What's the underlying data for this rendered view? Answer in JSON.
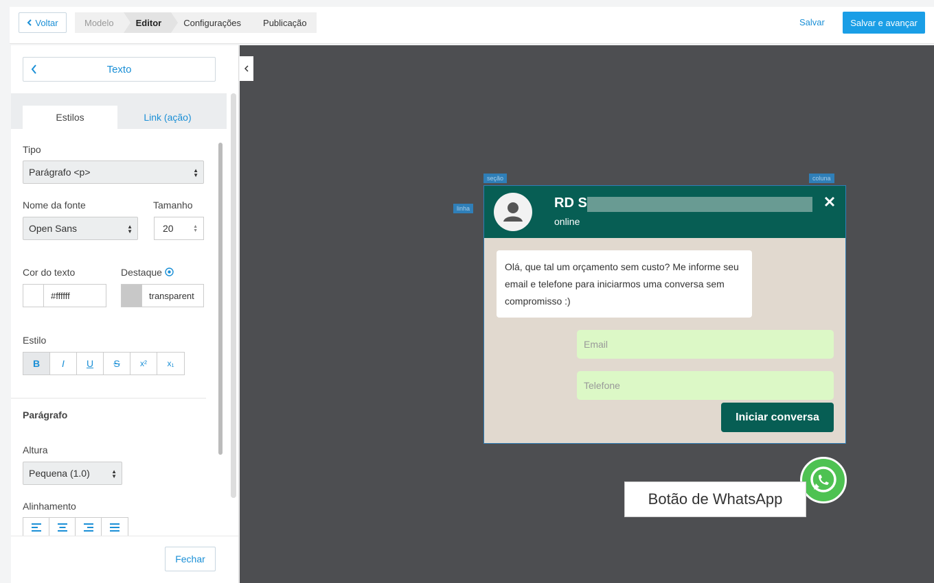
{
  "topbar": {
    "back_label": "Voltar",
    "steps": [
      {
        "label": "Modelo",
        "state": "done"
      },
      {
        "label": "Editor",
        "state": "active"
      },
      {
        "label": "Configurações",
        "state": "pending"
      },
      {
        "label": "Publicação",
        "state": "pending"
      }
    ],
    "save_label": "Salvar",
    "save_next_label": "Salvar e avançar"
  },
  "sidebar": {
    "panel_title": "Texto",
    "tabs": [
      "Estilos",
      "Link (ação)"
    ],
    "tipo_label": "Tipo",
    "tipo_value": "Parágrafo <p>",
    "fonte_label": "Nome da fonte",
    "fonte_value": "Open Sans",
    "tamanho_label": "Tamanho",
    "tamanho_value": "20",
    "cor_label": "Cor do texto",
    "cor_value": "#ffffff",
    "destaque_label": "Destaque",
    "destaque_value": "transparent",
    "estilo_label": "Estilo",
    "style_buttons": [
      "B",
      "I",
      "U",
      "S",
      "x²",
      "x₁"
    ],
    "paragrafo_label": "Parágrafo",
    "altura_label": "Altura",
    "altura_value": "Pequena (1.0)",
    "alinhamento_label": "Alinhamento",
    "close_label": "Fechar"
  },
  "canvas": {
    "tags": [
      "seção",
      "coluna",
      "linha"
    ],
    "chat": {
      "name": "RD S",
      "status": "online",
      "message": "Olá, que tal um orçamento sem custo? Me informe seu email e telefone para iniciarmos uma conversa sem compromisso :)",
      "email_placeholder": "Email",
      "phone_placeholder": "Telefone",
      "start_label": "Iniciar conversa"
    },
    "tooltip": "Botão de WhatsApp"
  },
  "colors": {
    "accent": "#1a9ee6",
    "whatsapp_header": "#075e54",
    "whatsapp_input": "#dcf8c6",
    "whatsapp_green": "#4ec252",
    "canvas_bg": "#4d4e51"
  }
}
